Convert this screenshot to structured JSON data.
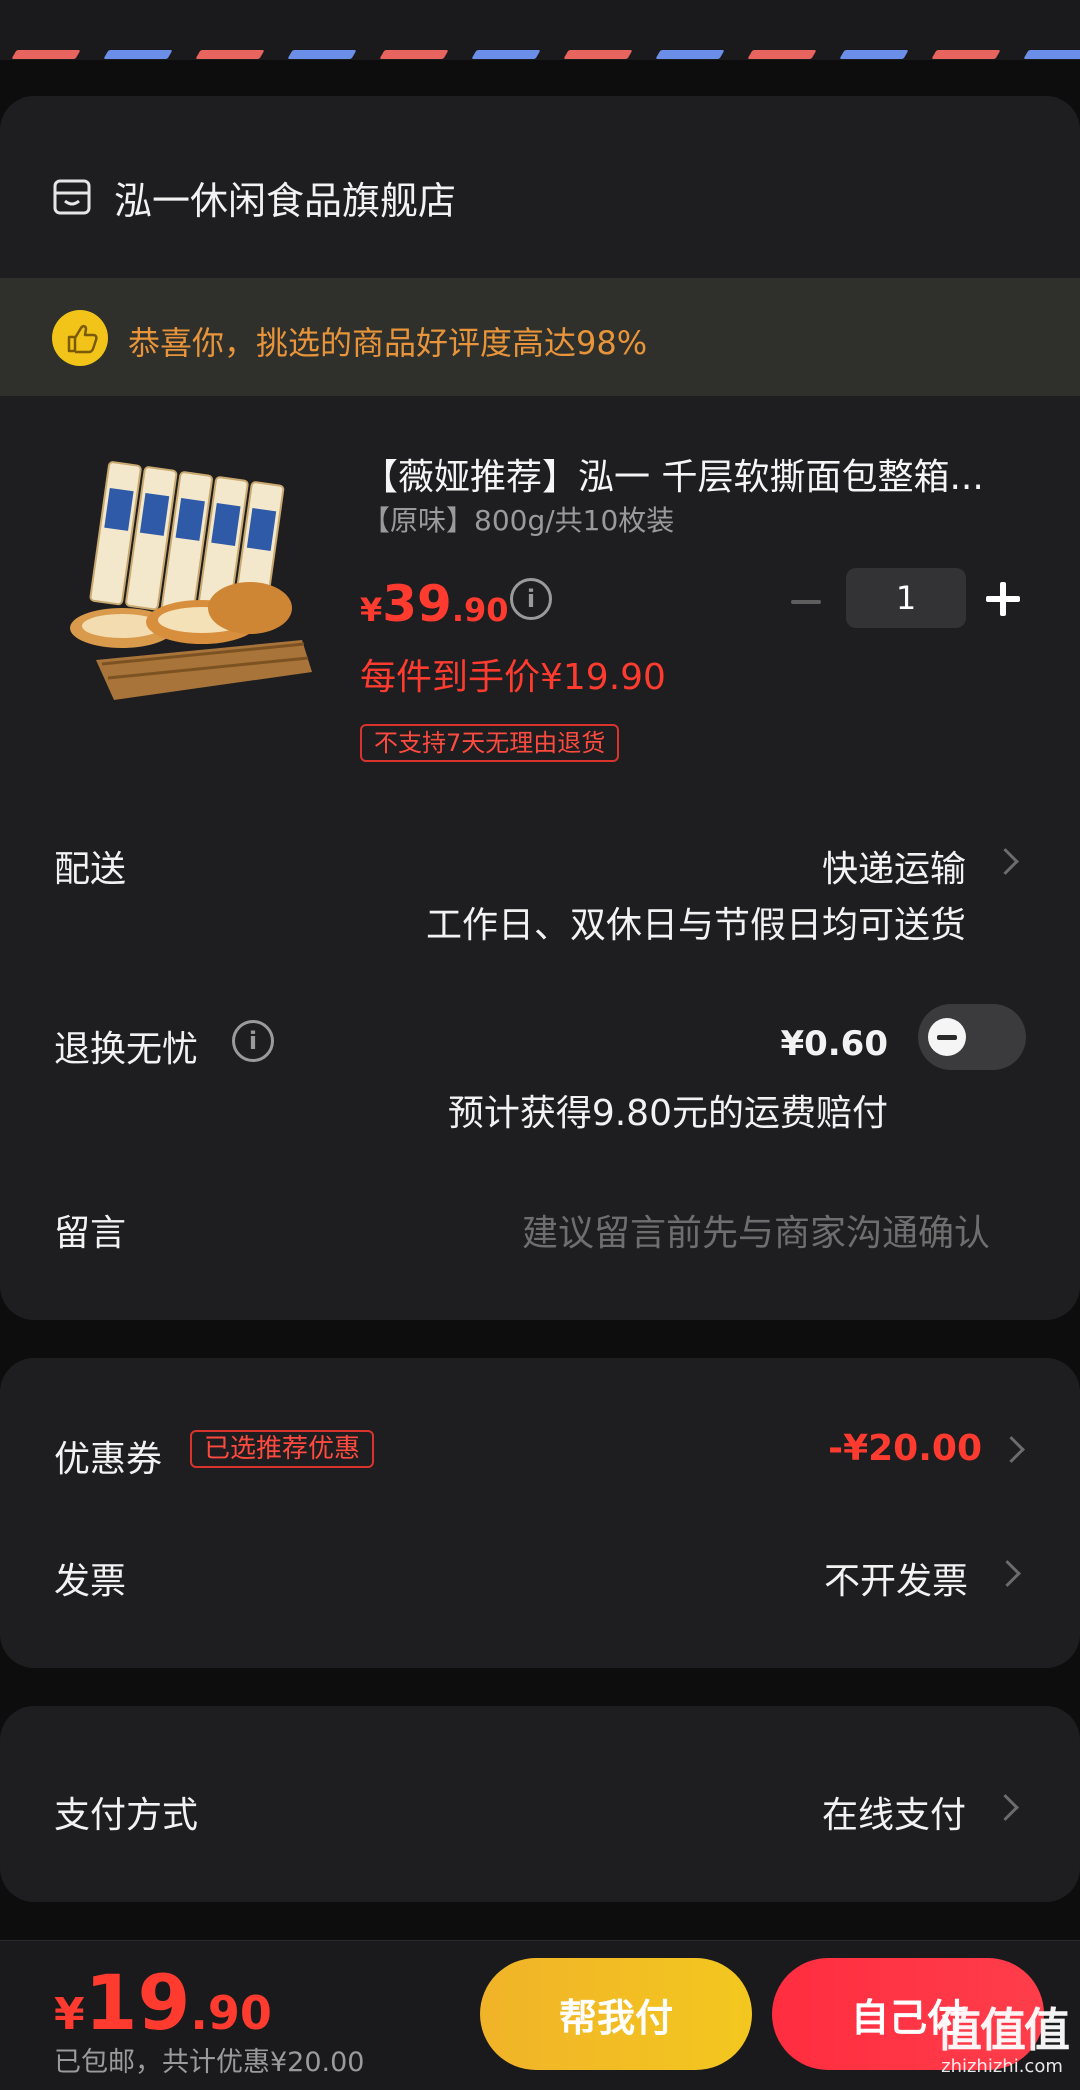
{
  "shop": {
    "name": "泓一休闲食品旗舰店"
  },
  "banner": {
    "text": "恭喜你，挑选的商品好评度高达98%"
  },
  "product": {
    "title": "【薇娅推荐】泓一 千层软撕面包整箱...",
    "variant": "【原味】800g/共10枚装",
    "price_currency": "¥",
    "price_int": "39",
    "price_dec": ".90",
    "per_price": "每件到手价¥19.90",
    "quantity": "1",
    "no_return_tag": "不支持7天无理由退货"
  },
  "delivery": {
    "label": "配送",
    "value": "快递运输",
    "note": "工作日、双休日与节假日均可送货"
  },
  "return_insurance": {
    "label": "退换无忧",
    "price": "¥0.60",
    "note": "预计获得9.80元的运费赔付"
  },
  "message": {
    "label": "留言",
    "placeholder": "建议留言前先与商家沟通确认"
  },
  "coupon": {
    "label": "优惠券",
    "tag": "已选推荐优惠",
    "value": "-¥20.00"
  },
  "invoice": {
    "label": "发票",
    "value": "不开发票"
  },
  "payment": {
    "label": "支付方式",
    "value": "在线支付"
  },
  "footer": {
    "total_currency": "¥",
    "total_int": "19",
    "total_dec": ".90",
    "summary": "已包邮，共计优惠¥20.00",
    "help_pay_label": "帮我付",
    "self_pay_label": "自己付"
  },
  "watermark": {
    "big": "值值值",
    "small": "zhizhizhi.com"
  },
  "colors": {
    "accent_red": "#ff3b30",
    "banner_orange": "#e7943a",
    "help_yellow": "#f3c71f",
    "self_red": "#ff2d3f"
  }
}
